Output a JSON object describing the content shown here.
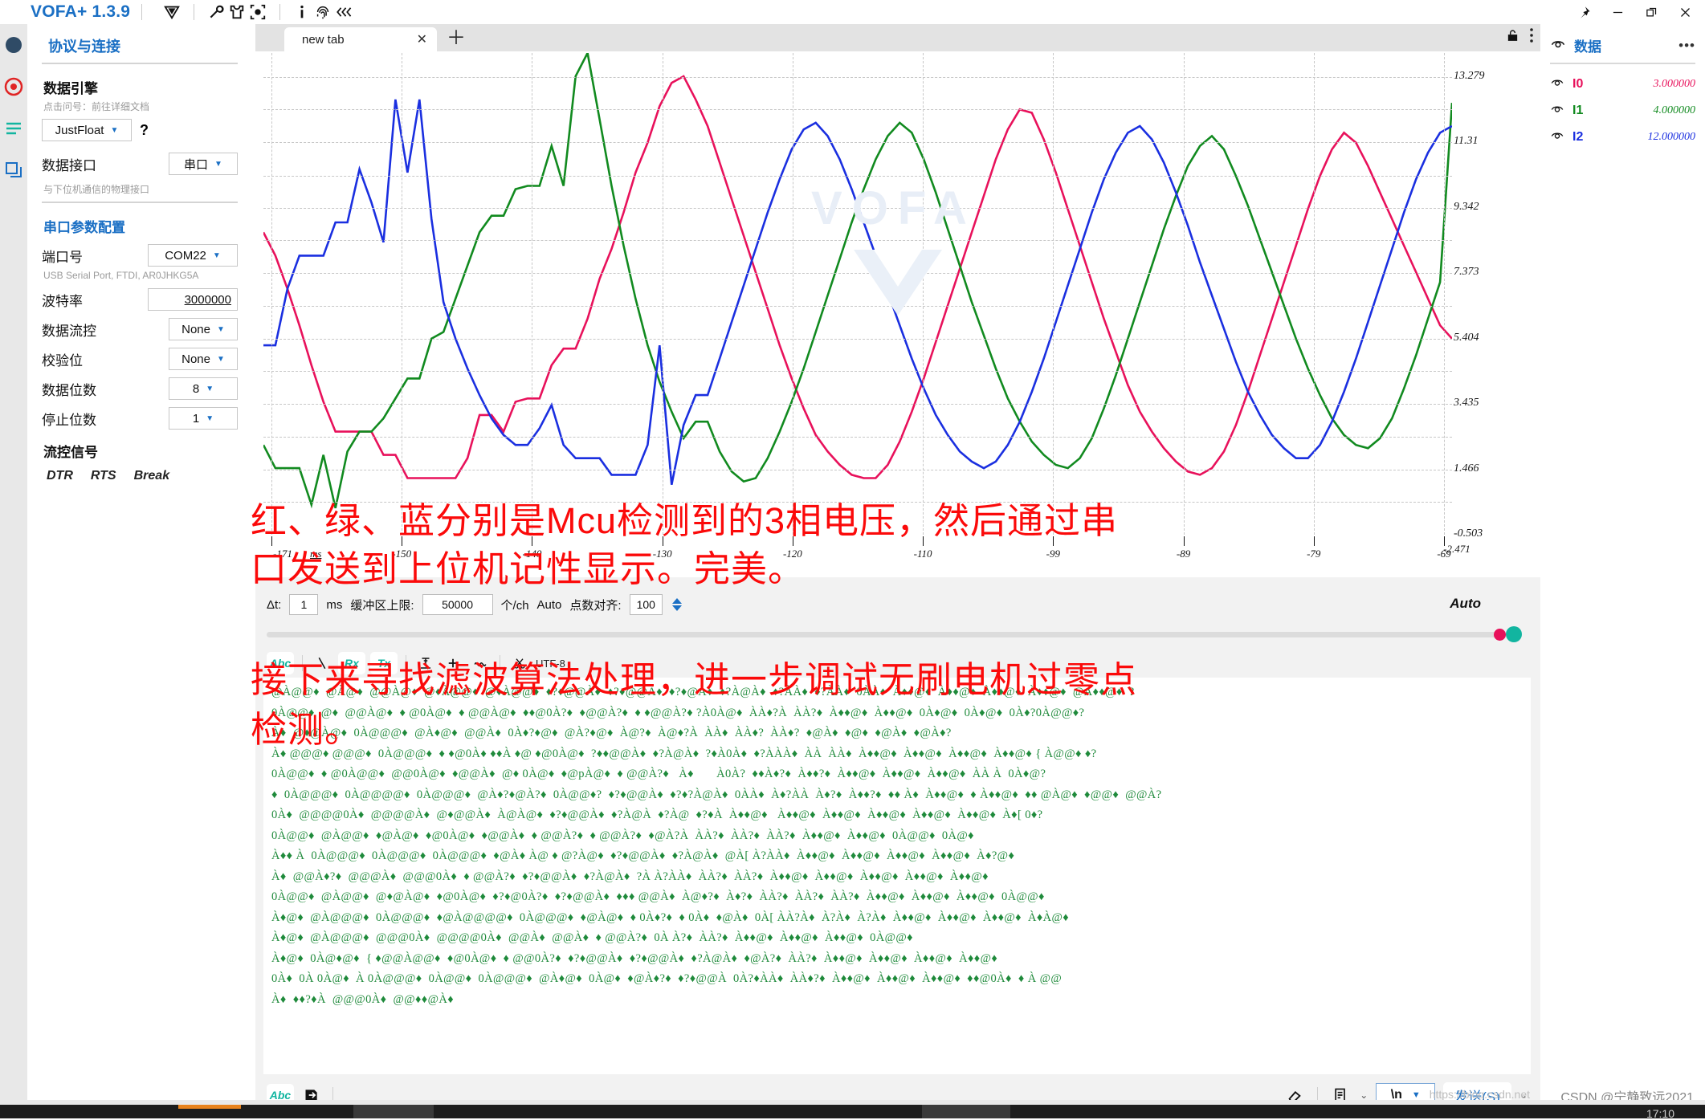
{
  "titlebar": {
    "app_title": "VOFA+ 1.3.9",
    "icons": [
      "logo-v-icon",
      "wrench-icon",
      "shirt-icon",
      "target-icon",
      "info-icon",
      "fingerprint-icon",
      "collapse-left-icon"
    ],
    "window": [
      "pin-icon",
      "minimize-icon",
      "restore-icon",
      "close-icon"
    ]
  },
  "sidebar": {
    "title": "协议与连接",
    "data_engine": {
      "label": "数据引擎",
      "hint": "点击问号：前往详细文档",
      "value": "JustFloat",
      "help": "?"
    },
    "data_interface": {
      "label": "数据接口",
      "value": "串口",
      "hint": "与下位机通信的物理接口"
    },
    "serial_section_title": "串口参数配置",
    "rows": [
      {
        "label": "端口号",
        "value": "COM22",
        "hint": "USB Serial Port, FTDI, AR0JHKG5A"
      },
      {
        "label": "波特率",
        "value": "3000000",
        "hint": ""
      },
      {
        "label": "数据流控",
        "value": "None",
        "hint": ""
      },
      {
        "label": "校验位",
        "value": "None",
        "hint": ""
      },
      {
        "label": "数据位数",
        "value": "8",
        "hint": ""
      },
      {
        "label": "停止位数",
        "value": "1",
        "hint": ""
      }
    ],
    "flow_label": "流控信号",
    "flow_signals": [
      "DTR",
      "RTS",
      "Break"
    ]
  },
  "tabs": {
    "active_label": "new tab",
    "close_glyph": "✕",
    "add_glyph": "＋",
    "lock_icon": "lock-icon",
    "menu_icon": "kebab-menu-icon"
  },
  "chart_data": {
    "type": "line",
    "title": "",
    "xlabel": "ms",
    "ylabel": "",
    "grid": true,
    "legend_position": "right-panel",
    "xlim": [
      -171,
      -69
    ],
    "ylim": [
      -0.503,
      14.0
    ],
    "x_unit": "ms",
    "x_ticks": [
      "-171",
      "-150",
      "-140",
      "-130",
      "-120",
      "-110",
      "-99",
      "-89",
      "-79",
      "-69"
    ],
    "x_edge_label": "-2.471",
    "y_ticks": [
      "13.279",
      "11.31",
      "9.342",
      "7.373",
      "5.404",
      "3.435",
      "1.466",
      "-0.503"
    ],
    "watermark": "VOFA",
    "series": [
      {
        "name": "I0",
        "color": "#e8115b",
        "values": [
          8.6,
          7.9,
          6.9,
          5.8,
          4.6,
          3.5,
          2.6,
          2.6,
          2.6,
          2.6,
          1.9,
          1.9,
          1.2,
          1.2,
          1.2,
          1.2,
          1.2,
          1.8,
          3.1,
          3.1,
          2.6,
          3.5,
          3.6,
          3.6,
          4.6,
          5.1,
          5.1,
          6.0,
          7.2,
          8.1,
          9.2,
          10.4,
          11.3,
          12.4,
          13.1,
          13.3,
          12.6,
          11.8,
          10.7,
          9.6,
          8.5,
          7.4,
          6.3,
          5.2,
          4.2,
          3.3,
          2.5,
          2.0,
          1.6,
          1.3,
          1.2,
          1.2,
          1.6,
          2.3,
          3.2,
          4.2,
          5.3,
          6.4,
          7.5,
          8.6,
          9.7,
          10.8,
          11.7,
          12.3,
          12.2,
          11.4,
          10.4,
          9.3,
          8.2,
          7.1,
          6.0,
          5.0,
          4.0,
          3.2,
          2.6,
          2.1,
          1.7,
          1.4,
          1.3,
          1.5,
          2.0,
          2.8,
          3.8,
          4.9,
          6.0,
          7.1,
          8.2,
          9.3,
          10.3,
          11.1,
          11.6,
          11.3,
          10.6,
          9.8,
          9.0,
          8.2,
          7.4,
          6.6,
          5.8,
          5.4
        ]
      },
      {
        "name": "I1",
        "color": "#118a1f",
        "values": [
          2.2,
          1.5,
          1.5,
          1.5,
          0.4,
          1.9,
          0.3,
          2.0,
          2.6,
          2.6,
          3.0,
          3.6,
          4.2,
          4.2,
          5.4,
          5.6,
          6.6,
          7.6,
          8.6,
          9.1,
          9.1,
          9.9,
          10.0,
          10.0,
          11.2,
          10.0,
          13.3,
          14.0,
          12.0,
          10.0,
          8.2,
          6.6,
          5.2,
          4.1,
          3.2,
          2.4,
          2.9,
          2.9,
          2.0,
          1.4,
          1.1,
          1.2,
          1.8,
          2.6,
          3.5,
          4.5,
          5.6,
          6.7,
          7.8,
          8.9,
          9.9,
          10.8,
          11.5,
          11.9,
          11.6,
          10.8,
          9.8,
          8.7,
          7.6,
          6.5,
          5.5,
          4.5,
          3.6,
          2.9,
          2.3,
          1.9,
          1.6,
          1.5,
          1.8,
          2.4,
          3.3,
          4.3,
          5.4,
          6.5,
          7.6,
          8.7,
          9.7,
          10.6,
          11.2,
          11.5,
          11.1,
          10.3,
          9.4,
          8.4,
          7.4,
          6.4,
          5.4,
          4.5,
          3.7,
          3.0,
          2.5,
          2.2,
          2.1,
          2.4,
          3.0,
          3.9,
          4.9,
          6.0,
          7.1,
          12.5
        ]
      },
      {
        "name": "I2",
        "color": "#1a2fe0",
        "values": [
          5.2,
          5.2,
          6.9,
          7.9,
          7.9,
          7.9,
          8.9,
          8.9,
          10.5,
          9.5,
          8.3,
          12.6,
          10.4,
          12.6,
          9.0,
          6.5,
          5.4,
          4.5,
          3.7,
          3.0,
          2.5,
          2.2,
          2.2,
          2.7,
          3.4,
          2.2,
          1.8,
          1.8,
          1.8,
          1.3,
          1.3,
          1.3,
          2.2,
          5.2,
          1.0,
          2.8,
          3.7,
          3.7,
          4.8,
          5.9,
          7.0,
          8.1,
          9.2,
          10.2,
          11.1,
          11.7,
          11.9,
          11.5,
          10.8,
          9.9,
          8.9,
          7.9,
          6.8,
          5.8,
          4.8,
          3.9,
          3.1,
          2.5,
          2.0,
          1.7,
          1.5,
          1.7,
          2.2,
          2.9,
          3.8,
          4.8,
          5.9,
          7.0,
          8.1,
          9.2,
          10.2,
          11.0,
          11.6,
          11.8,
          11.4,
          10.7,
          9.8,
          8.8,
          7.7,
          6.7,
          5.7,
          4.7,
          3.8,
          3.1,
          2.5,
          2.1,
          1.8,
          1.8,
          2.2,
          2.9,
          3.8,
          4.8,
          5.9,
          7.0,
          8.1,
          9.2,
          10.2,
          11.0,
          11.6,
          11.8
        ]
      }
    ]
  },
  "plot_controls": {
    "dt_label": "Δt:",
    "dt_value": "1",
    "dt_unit": "ms",
    "buffer_label": "缓冲区上限:",
    "buffer_value": "50000",
    "buffer_unit": "个/ch",
    "auto_label_inline": "Auto",
    "align_label": "点数对齐:",
    "align_value": "100",
    "auto_label": "Auto"
  },
  "terminal_toolbar": {
    "abc": "Abc",
    "rx": "Rx",
    "tx": "Tx",
    "encoding": "UTF-8",
    "icons": [
      "backslash-icon",
      "align-icon",
      "plus-icon",
      "wave-icon",
      "scissors-icon"
    ]
  },
  "terminal_text": [
    "@À@@♦  @À@♦  @@À@♦  @♦À@@♦  @♦À@@♦  ♦?♦@@À♦  ♦?♦@@À♦  ♦?♦@À♦  ♦?À@À♦  ♦?ÀÀ♦  ♦?ÀÀ♦  0ÀÀ♦  À♦♦@♦  À♦♦@♦  À♦♦@♦  À♦♦@♦  @À♦♦@♦  ?",
    "0À@@♦  @♦  @@À@♦  ♦ @0À@♦  ♦ @@À@♦  ♦♦@0À?♦  ♦@@À?♦  ♦ ♦@@À?♦ ?À0À@♦  ÀÀ♦?À  ÀÀ?♦  À♦♦@♦  À♦♦@♦  0À♦@♦  0À♦@♦  0À♦?0À@@♦?",
    "À♦  @♦@À@♦  0À@@@♦  @À♦@♦  @@À♦  0À♦?♦@♦  @À?♦@♦  À@?♦  À@♦?À  ÀÀ♦  ÀÀ♦?  ÀÀ♦?  ♦@À♦  ♦@♦  ♦@À♦  ♦@À♦?",
    "À♦ @@@♦ @@@♦  0À@@@♦  ♦ ♦@0À♦ ♦♦À ♦@ ♦@0À@♦  ?♦♦@@À♦  ♦?À@À♦  ?♦À0À♦  ♦?ÀÀÀ♦  ÀÀ  ÀÀ♦  À♦♦@♦  À♦♦@♦  À♦♦@♦  À♦♦@♦ { À@@♦ ♦?",
    "0À@@♦  ♦ @0À@@♦  @@0À@♦  ♦@@À♦  @♦ 0À@♦  ♦@pÀ@♦  ♦ @@À?♦   À♦       À0À?  ♦♦À♦?♦  À♦♦?♦  À♦♦@♦  À♦♦@♦  À♦♦@♦  ÀÀ À  0À♦@?",
    "♦  0À@@@♦  0À@@@@♦  0À@@@♦  @À♦?♦@À?♦  0À@@♦?  ♦?♦@@À♦  ♦?♦?À@À♦  0ÀÀ♦  À♦?ÀÀ  À♦?♦  À♦♦?♦  ♦♦ À♦  À♦♦@♦  ♦ À♦♦@♦  ♦♦ @À@♦  ♦@@♦  @@À?",
    "0À♦  @@@@0À♦  @@@@À♦  @♦@@À♦  À@À@♦  ♦?♦@@À♦  ♦?À@À  ♦?À@  ♦?♦À  À♦♦@♦   À♦♦@♦  À♦♦@♦  À♦♦@♦  À♦♦@♦  À♦♦@♦  À♦[ 0♦?",
    "0À@@♦  @À@@♦  ♦@À@♦  ♦@0À@♦  ♦@@À♦  ♦ @@À?♦  ♦ @@À?♦  ♦@À?À  ÀÀ?♦  ÀÀ?♦  ÀÀ?♦  À♦♦@♦  À♦♦@♦  0À@@♦  0À@♦",
    "À♦♦ À  0À@@@♦  0À@@@♦  0À@@@♦  ♦@À♦ À@ ♦ @?À@♦  ♦?♦@@À♦  ♦?À@À♦  @À[ À?ÀÀ♦  À♦♦@♦  À♦♦@♦  À♦♦@♦  À♦♦@♦  À♦?@♦",
    "À♦  @@À♦?♦  @@@À♦  @@@0À♦  ♦ @@À?♦  ♦?♦@@À♦  ♦?À@À♦  ?À À?ÀÀ♦  ÀÀ?♦  ÀÀ?♦  À♦♦@♦  À♦♦@♦  À♦♦@♦  À♦♦@♦  À♦♦@♦",
    "0À@@♦  @À@@♦  @♦@À@♦  ♦@0À@♦  ♦?♦@0À?♦  ♦?♦@@À♦  ♦♦♦ @@À♦  À@♦?♦  À♦?♦  ÀÀ?♦  ÀÀ?♦  ÀÀ?♦  À♦♦@♦  À♦♦@♦  À♦♦@♦  0À@@♦",
    "À♦@♦  @À@@@♦  0À@@@♦  ♦@À@@@@♦  0À@@@♦  ♦@À@♦  ♦ 0À♦?♦  ♦ 0À♦  ♦@À♦  0À[ ÀÀ?À♦  À?À♦  À?À♦  À♦♦@♦  À♦♦@♦  À♦♦@♦  À♦À@♦",
    "À♦@♦  @À@@@♦  @@@0À♦  @@@@0À♦  @@À♦  @@À♦  ♦ @@À?♦  0À À?♦  ÀÀ?♦  À♦♦@♦  À♦♦@♦  À♦♦@♦  0À@@♦",
    "À♦@♦  0À@♦@♦  { ♦@@À@@♦  ♦@0À@♦  ♦ @@0À?♦  ♦?♦@@À♦  ♦?♦@@À♦  ♦?À@À♦  ♦@À?♦  ÀÀ?♦  À♦♦@♦  À♦♦@♦  À♦♦@♦  À♦♦@♦",
    "0À♦  0À 0À@♦  À 0À@@@♦  0À@@♦  0À@@@♦  @À♦@♦  0À@♦  ♦@À♦?♦  ♦?♦@@À  0À?♦ÀÀ♦  ÀÀ♦?♦  À♦♦@♦  À♦♦@♦  À♦♦@♦  ♦♦@0À♦  ♦ À @@",
    "À♦  ♦♦?♦À  @@@0À♦  @@♦♦@À♦"
  ],
  "send_bar": {
    "abc": "Abc",
    "export_icon": "export-file-icon",
    "eraser_icon": "eraser-icon",
    "script_icon": "script-icon",
    "newline_value": "\\n",
    "send_label": "发送(S)"
  },
  "right_panel": {
    "title": "数据",
    "eye_icon": "eye-icon",
    "menu": "•••",
    "channels": [
      {
        "name": "I0",
        "value": "3.000000",
        "color": "#e8115b"
      },
      {
        "name": "I1",
        "value": "4.000000",
        "color": "#118a1f"
      },
      {
        "name": "I2",
        "value": "12.000000",
        "color": "#1a2fe0"
      }
    ]
  },
  "annotations": {
    "line1": "红、绿、蓝分别是Mcu检测到的3相电压，然后通过串",
    "line2": "口发送到上位机记性显示。完美。",
    "line3": "接下来寻找滤波算法处理，进一步调试无刷电机过零点",
    "line4": "检测。",
    "color": "#fb0a0a"
  },
  "footer": {
    "csdn_watermark": "CSDN @宁静致远2021",
    "url_watermark": "https://blog.csdn.net",
    "clock": "17:10"
  }
}
